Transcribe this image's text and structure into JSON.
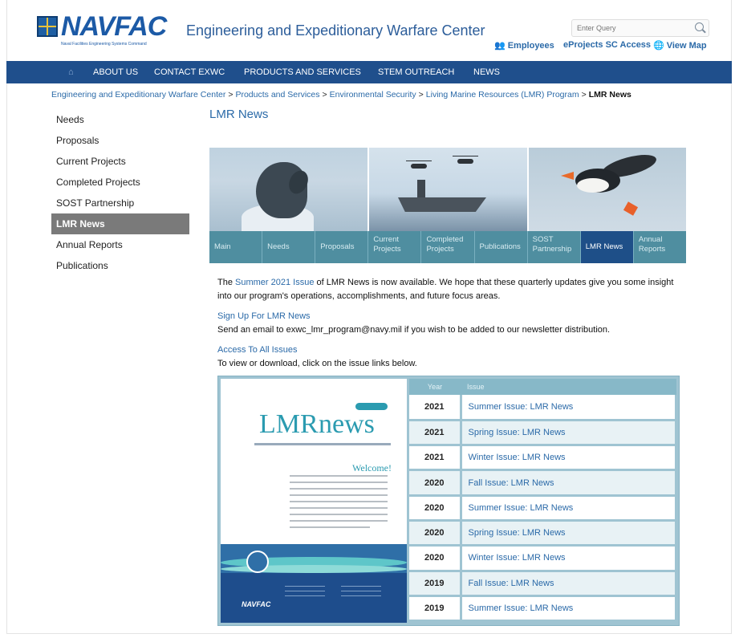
{
  "header": {
    "logo_text": "NAVFAC",
    "logo_subtitle": "Naval Facilities Engineering Systems Command",
    "site_title": "Engineering and Expeditionary Warfare Center",
    "search_placeholder": "Enter Query",
    "links": [
      {
        "icon": "people-icon",
        "label": "Employees"
      },
      {
        "icon": "",
        "label": "eProjects SC Access"
      },
      {
        "icon": "globe-icon",
        "label": "View Map"
      }
    ]
  },
  "nav": {
    "home_icon": "home-icon",
    "items": [
      "ABOUT US",
      "CONTACT EXWC",
      "PRODUCTS AND SERVICES",
      "STEM OUTREACH",
      "NEWS"
    ]
  },
  "breadcrumb": {
    "items": [
      "Engineering and Expeditionary Warfare Center",
      "Products and Services",
      "Environmental Security",
      "Living Marine Resources (LMR) Program"
    ],
    "separator": ">",
    "current": "LMR News"
  },
  "sidebar": {
    "items": [
      "Needs",
      "Proposals",
      "Current Projects",
      "Completed Projects",
      "SOST Partnership",
      "LMR News",
      "Annual Reports",
      "Publications"
    ],
    "active": "LMR News"
  },
  "main": {
    "title": "LMR News",
    "tabs": [
      {
        "label": "Main",
        "active": false
      },
      {
        "label": "Needs",
        "active": false
      },
      {
        "label": "Proposals",
        "active": false
      },
      {
        "label": "Current Projects",
        "active": false
      },
      {
        "label": "Completed Projects",
        "active": false
      },
      {
        "label": "Publications",
        "active": false
      },
      {
        "label": "SOST Partnership",
        "active": false
      },
      {
        "label": "LMR News",
        "active": true
      },
      {
        "label": "Annual Reports",
        "active": false
      }
    ],
    "intro_prefix": "The ",
    "intro_link": "Summer 2021 Issue",
    "intro_rest": " of LMR News is now available. We hope that these quarterly updates give you some insight into our program's operations, accomplishments, and future focus areas.",
    "signup_link": "Sign Up For LMR News",
    "signup_text": "Send an email to exwc_lmr_program@navy.mil if you wish to be added to our newsletter distribution.",
    "access_link": "Access To All Issues",
    "access_text": "To view or download, click on the issue links below."
  },
  "cover": {
    "lmr": "LMR",
    "news": "news",
    "welcome": "Welcome!",
    "footer_logo": "NAVFAC"
  },
  "issues": {
    "headers": [
      "Year",
      "Issue"
    ],
    "rows": [
      {
        "year": "2021",
        "issue": "Summer Issue: LMR News"
      },
      {
        "year": "2021",
        "issue": "Spring Issue: LMR News"
      },
      {
        "year": "2021",
        "issue": "Winter Issue: LMR News"
      },
      {
        "year": "2020",
        "issue": "Fall Issue: LMR News"
      },
      {
        "year": "2020",
        "issue": "Summer Issue: LMR News"
      },
      {
        "year": "2020",
        "issue": "Spring Issue: LMR News"
      },
      {
        "year": "2020",
        "issue": "Winter Issue: LMR News"
      },
      {
        "year": "2019",
        "issue": "Fall Issue: LMR News"
      },
      {
        "year": "2019",
        "issue": "Summer Issue: LMR News"
      }
    ]
  },
  "colors": {
    "nav_bg": "#1f4f8c",
    "tab_bg": "#4f8ea0",
    "tab_active": "#1e4f88",
    "link": "#2b6aa8",
    "sidebar_active": "#7a7a7a"
  }
}
